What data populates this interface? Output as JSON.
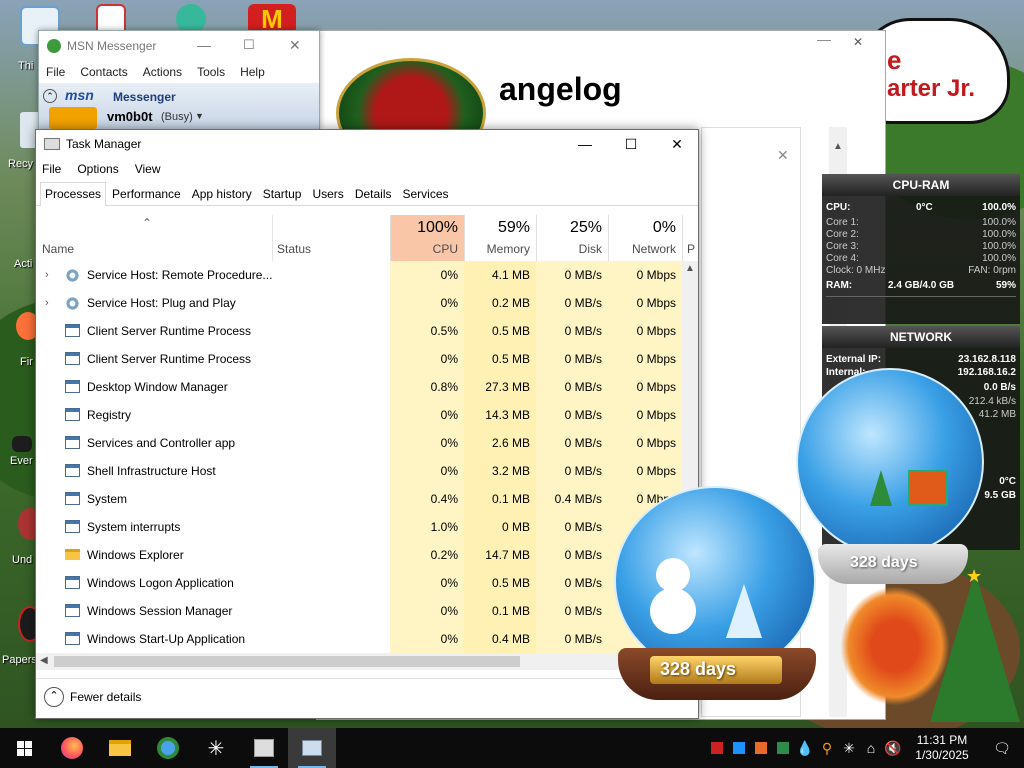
{
  "desktop": {
    "icons": [
      {
        "label": "Thi"
      },
      {
        "label": "Recy"
      },
      {
        "label": "Acti"
      },
      {
        "label": "Fir"
      },
      {
        "label": "Ever"
      },
      {
        "label": "Und"
      },
      {
        "label": "Papers"
      }
    ],
    "changelog_title": "angelog",
    "banner_text": "arter Jr."
  },
  "msn": {
    "title": "MSN Messenger",
    "menu": [
      "File",
      "Contacts",
      "Actions",
      "Tools",
      "Help"
    ],
    "brand_logo": "msn",
    "brand_text": "Messenger",
    "user": "vm0b0t",
    "status": "(Busy)"
  },
  "task_manager": {
    "title": "Task Manager",
    "menu": [
      "File",
      "Options",
      "View"
    ],
    "tabs": [
      "Processes",
      "Performance",
      "App history",
      "Startup",
      "Users",
      "Details",
      "Services"
    ],
    "active_tab": "Processes",
    "columns": {
      "name": "Name",
      "status": "Status",
      "cpu": {
        "pct": "100%",
        "label": "CPU"
      },
      "memory": {
        "pct": "59%",
        "label": "Memory"
      },
      "disk": {
        "pct": "25%",
        "label": "Disk"
      },
      "network": {
        "pct": "0%",
        "label": "Network"
      },
      "power": "P"
    },
    "rows": [
      {
        "name": "Service Host: Remote Procedure...",
        "cpu": "0%",
        "memory": "4.1 MB",
        "disk": "0 MB/s",
        "network": "0 Mbps",
        "icon": "gear-icon",
        "expandable": true
      },
      {
        "name": "Service Host: Plug and Play",
        "cpu": "0%",
        "memory": "0.2 MB",
        "disk": "0 MB/s",
        "network": "0 Mbps",
        "icon": "gear-icon",
        "expandable": true
      },
      {
        "name": "Client Server Runtime Process",
        "cpu": "0.5%",
        "memory": "0.5 MB",
        "disk": "0 MB/s",
        "network": "0 Mbps",
        "icon": "window-icon",
        "expandable": false
      },
      {
        "name": "Client Server Runtime Process",
        "cpu": "0%",
        "memory": "0.5 MB",
        "disk": "0 MB/s",
        "network": "0 Mbps",
        "icon": "window-icon",
        "expandable": false
      },
      {
        "name": "Desktop Window Manager",
        "cpu": "0.8%",
        "memory": "27.3 MB",
        "disk": "0 MB/s",
        "network": "0 Mbps",
        "icon": "window-icon",
        "expandable": false
      },
      {
        "name": "Registry",
        "cpu": "0%",
        "memory": "14.3 MB",
        "disk": "0 MB/s",
        "network": "0 Mbps",
        "icon": "window-icon",
        "expandable": false
      },
      {
        "name": "Services and Controller app",
        "cpu": "0%",
        "memory": "2.6 MB",
        "disk": "0 MB/s",
        "network": "0 Mbps",
        "icon": "window-icon",
        "expandable": false
      },
      {
        "name": "Shell Infrastructure Host",
        "cpu": "0%",
        "memory": "3.2 MB",
        "disk": "0 MB/s",
        "network": "0 Mbps",
        "icon": "window-icon",
        "expandable": false
      },
      {
        "name": "System",
        "cpu": "0.4%",
        "memory": "0.1 MB",
        "disk": "0.4 MB/s",
        "network": "0 Mbps",
        "icon": "window-icon",
        "expandable": false
      },
      {
        "name": "System interrupts",
        "cpu": "1.0%",
        "memory": "0 MB",
        "disk": "0 MB/s",
        "network": "",
        "icon": "window-icon",
        "expandable": false
      },
      {
        "name": "Windows Explorer",
        "cpu": "0.2%",
        "memory": "14.7 MB",
        "disk": "0 MB/s",
        "network": "",
        "icon": "folder-icon",
        "expandable": false
      },
      {
        "name": "Windows Logon Application",
        "cpu": "0%",
        "memory": "0.5 MB",
        "disk": "0 MB/s",
        "network": "",
        "icon": "window-icon",
        "expandable": false
      },
      {
        "name": "Windows Session Manager",
        "cpu": "0%",
        "memory": "0.1 MB",
        "disk": "0 MB/s",
        "network": "",
        "icon": "window-icon",
        "expandable": false
      },
      {
        "name": "Windows Start-Up Application",
        "cpu": "0%",
        "memory": "0.4 MB",
        "disk": "0 MB/s",
        "network": "",
        "icon": "window-icon",
        "expandable": false
      }
    ],
    "fewer_details": "Fewer details"
  },
  "gadgets": {
    "cpu_ram": {
      "title": "CPU-RAM",
      "cpu_label": "CPU:",
      "cpu_temp": "0°C",
      "cpu_value": "100.0%",
      "cores": [
        {
          "label": "Core 1:",
          "value": "100.0%"
        },
        {
          "label": "Core 2:",
          "value": "100.0%"
        },
        {
          "label": "Core 3:",
          "value": "100.0%"
        },
        {
          "label": "Core 4:",
          "value": "100.0%"
        }
      ],
      "clock": "Clock: 0 MHz",
      "fan": "FAN: 0rpm",
      "ram_label": "RAM:",
      "ram_value": "2.4 GB/4.0 GB",
      "ram_pct": "59%"
    },
    "network": {
      "title": "NETWORK",
      "external_label": "External IP:",
      "external_ip": "23.162.8.118",
      "internal_label": "Internal:",
      "internal_ip": "192.168.16.2",
      "rate1": "0.0 B/s",
      "rate2": "212.4 kB/s",
      "rate3": "41.2 MB"
    },
    "extra": {
      "temp": "0°C",
      "storage": "9.5 GB"
    },
    "globe_days_large": "328 days",
    "globe_days_small": "328 days"
  },
  "taskbar": {
    "time": "11:31 PM",
    "date": "1/30/2025"
  }
}
